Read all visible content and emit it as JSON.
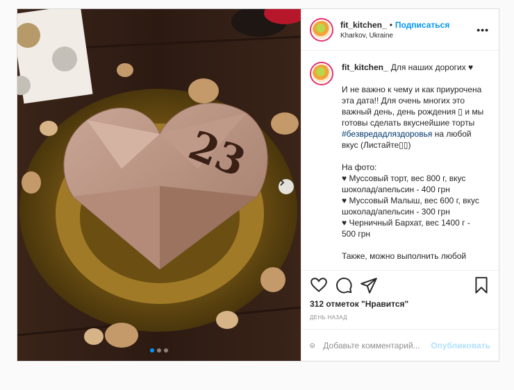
{
  "post": {
    "username": "fit_kitchen_",
    "separator": "•",
    "follow_label": "Подписаться",
    "location": "Kharkov, Ukraine",
    "more_icon": "more-dots-icon",
    "caption": {
      "first_line": "Для наших дорогих ♥",
      "para1": "И не важно к чему и как приурочена эта дата!! Для очень многих это важный день, день рождения ▯ и мы готовы сделать вкуснейшие торты",
      "hashtag": "#безвредадляздоровья",
      "para1_end": "на любой вкус (Листайте▯▯)",
      "photo_label": "На фото:",
      "items": [
        "♥ Муссовый торт, вес 800 г, вкус шоколад/апельсин - 400 грн",
        "♥ Муссовый Малыш, вес 600 г, вкус шоколад/апельсин - 300 грн",
        "♥ Черничный Бархат, вес 1400 г - 500 грн"
      ],
      "tail": "Также, можно выполнить любой"
    },
    "image": {
      "cake_number": "23",
      "carousel_total": 3,
      "carousel_active": 1
    },
    "likes": "312 отметок \"Нравится\"",
    "time": "день назад",
    "comment_placeholder": "Добавьте комментарий...",
    "publish_label": "Опубликовать",
    "colors": {
      "accent": "#0095f6",
      "publish_disabled": "#b2dffc",
      "hashtag": "#00376b"
    }
  }
}
